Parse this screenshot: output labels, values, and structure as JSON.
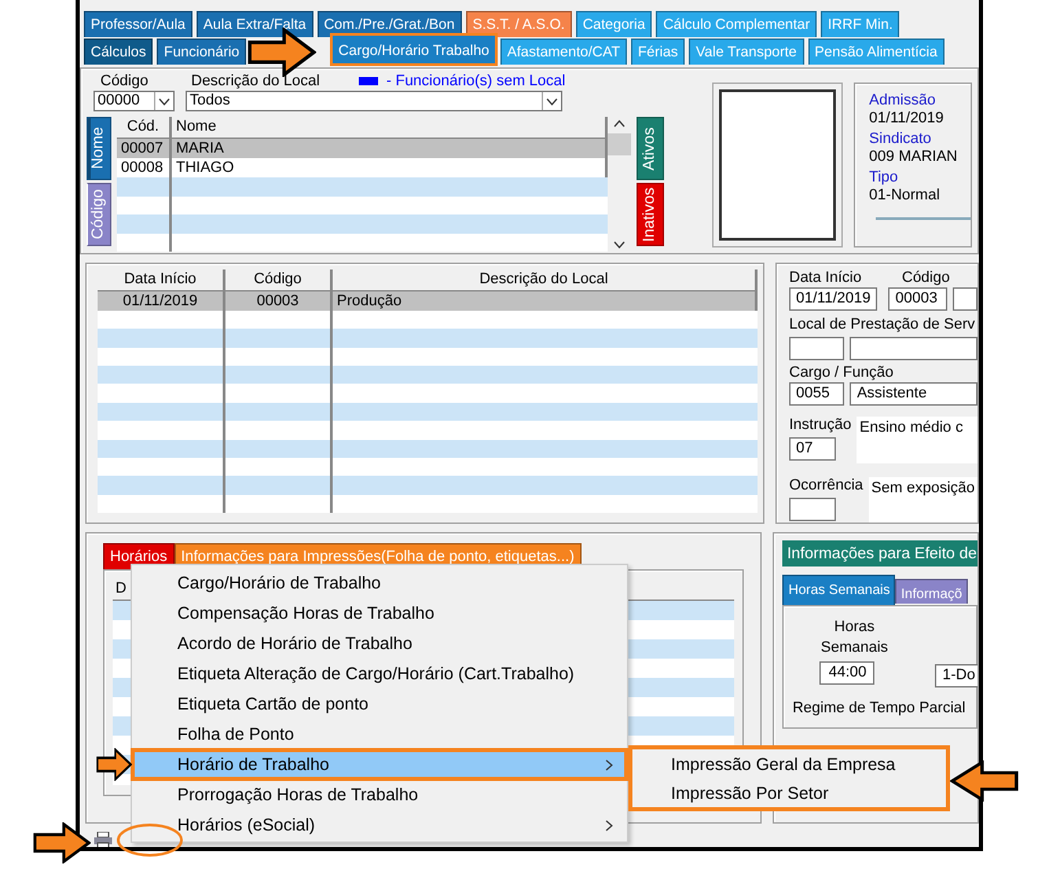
{
  "tabs_row_1": [
    {
      "label": "Professor/Aula",
      "color": "#1a6fb0"
    },
    {
      "label": "Aula Extra/Falta",
      "color": "#1a6fb0"
    },
    {
      "label": "Com./Pre./Grat./Bon",
      "color": "#1a6fb0"
    },
    {
      "label": "S.S.T. / A.S.O.",
      "color": "#f5834a"
    },
    {
      "label": "Categoria",
      "color": "#29a9ea"
    },
    {
      "label": "Cálculo Complementar",
      "color": "#29a9ea"
    },
    {
      "label": "IRRF Min.",
      "color": "#29a9ea"
    }
  ],
  "tabs_row_2": [
    {
      "label": "Cálculos",
      "color": "#0f5a8a",
      "selected": false
    },
    {
      "label": "Funcionário",
      "color": "#1a6fb0",
      "selected": false
    },
    {
      "label": "Cargo/Horário Trabalho",
      "color": "#1a7fc4",
      "selected": true
    },
    {
      "label": "Afastamento/CAT",
      "color": "#29a9ea",
      "selected": false
    },
    {
      "label": "Férias",
      "color": "#29a9ea",
      "selected": false
    },
    {
      "label": "Vale Transporte",
      "color": "#29a9ea",
      "selected": false
    },
    {
      "label": "Pensão Alimentícia",
      "color": "#29a9ea",
      "selected": false
    }
  ],
  "filter": {
    "code_label": "Código",
    "code_value": "00000",
    "local_label": "Descrição do Local",
    "local_value": "Todos",
    "legend": {
      "text": "- Funcionário(s) sem Local",
      "color": "#0000ff"
    }
  },
  "sort_tabs": [
    {
      "label": "Nome",
      "color": "#1a6fb0",
      "selected": true
    },
    {
      "label": "Código",
      "color": "#8a84c8",
      "selected": false
    }
  ],
  "employees": {
    "columns": [
      "Cód.",
      "Nome"
    ],
    "rows": [
      {
        "cells": [
          "00007",
          "MARIA"
        ],
        "selected": true
      },
      {
        "cells": [
          "00008",
          "THIAGO"
        ],
        "selected": false
      }
    ]
  },
  "status_tabs": [
    {
      "label": "Ativos",
      "color": "#1a8070"
    },
    {
      "label": "Inativos",
      "color": "#e00000"
    }
  ],
  "employee_info": [
    {
      "label": "Admissão",
      "value": "01/11/2019"
    },
    {
      "label": "Sindicato",
      "value": "009  MARIAN"
    },
    {
      "label": "Tipo",
      "value": "01-Normal"
    }
  ],
  "history": {
    "columns": [
      "Data Início",
      "Código",
      "Descrição do Local"
    ],
    "rows": [
      {
        "cells": [
          "01/11/2019",
          "00003",
          "Produção"
        ],
        "selected": true
      }
    ]
  },
  "detail": {
    "date_label": "Data Início",
    "date_value": "01/11/2019",
    "code_label": "Código",
    "code_value": "00003",
    "local_label": "Local de Prestação de Serv",
    "role_label": "Cargo  /  Função",
    "role_code": "0055",
    "role_name": "Assistente",
    "education_label": "Instrução",
    "education_code": "07",
    "education_text": "Ensino médio c",
    "occurrence_label": "Ocorrência",
    "occurrence_text": "Sem exposição"
  },
  "schedule_tabs": [
    {
      "label": "Horários",
      "color": "#e00000"
    },
    {
      "label": "Informações para Impressões(Folha de ponto, etiquetas...)",
      "color": "#f5831f"
    }
  ],
  "schedule_table": {
    "columns": [
      "D"
    ]
  },
  "effects": {
    "button": "Informações para Efeito de",
    "tabs": [
      {
        "label": "Horas Semanais",
        "color": "#1a7fc4",
        "selected": true
      },
      {
        "label": "Informaçõ",
        "color": "#8a84c8",
        "selected": false
      }
    ],
    "hours_label": "Horas Semanais",
    "hours_value": "44:00",
    "field_value": "1-Do",
    "regime_label": "Regime de Tempo Parcial"
  },
  "context_menu": {
    "items": [
      {
        "label": "Cargo/Horário de Trabalho",
        "selected": false,
        "submenu": false
      },
      {
        "label": "Compensação Horas de Trabalho",
        "selected": false,
        "submenu": false
      },
      {
        "label": "Acordo de Horário de Trabalho",
        "selected": false,
        "submenu": false
      },
      {
        "label": "Etiqueta Alteração de Cargo/Horário (Cart.Trabalho)",
        "selected": false,
        "submenu": false
      },
      {
        "label": "Etiqueta Cartão de ponto",
        "selected": false,
        "submenu": false
      },
      {
        "label": "Folha de Ponto",
        "selected": false,
        "submenu": false
      },
      {
        "label": "Horário de Trabalho",
        "selected": true,
        "submenu": true
      },
      {
        "label": "Prorrogação Horas de Trabalho",
        "selected": false,
        "submenu": false
      },
      {
        "label": "Horários (eSocial)",
        "selected": false,
        "submenu": true
      }
    ]
  },
  "submenu": {
    "items": [
      "Impressão Geral da Empresa",
      "Impressão Por Setor"
    ]
  }
}
